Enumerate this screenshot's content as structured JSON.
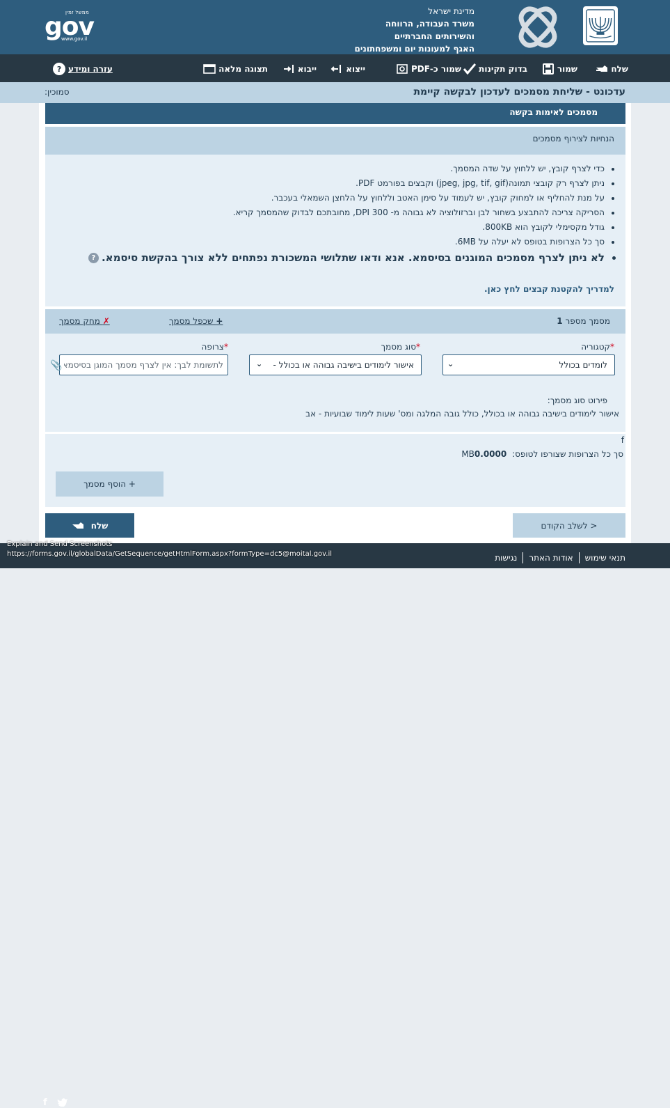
{
  "header": {
    "ministry_lines": [
      "מדינת ישראל",
      "משרד העבודה, הרווחה",
      "והשירותים החברתיים",
      "האגף למעונות יום ומשפחתונים"
    ],
    "gov_logo": {
      "top": "ממשל זמין",
      "main": "gov",
      "url": "www.gov.il"
    }
  },
  "toolbar": {
    "send": "שלח",
    "save": "שמור",
    "validate": "בדוק תקינות",
    "save_pdf": "שמור כ-PDF",
    "export": "ייצוא",
    "import": "ייבוא",
    "fullscreen": "תצוגה מלאה",
    "help": "עזרה ומידע",
    "help_icon_glyph": "?"
  },
  "titlebar": {
    "title": "עדכונט - שליחת מסמכים לעדכון לבקשה קיימת",
    "smochin": "סמוכין:"
  },
  "section": {
    "title": "מסמכים לאימות בקשה",
    "instructions_title": "הנחיות לצירוף מסמכים",
    "instructions": [
      "כדי לצרף קובץ, יש ללחוץ על שדה המסמך.",
      "ניתן לצרף רק קובצי תמונה(jpeg, jpg, tif, gif) וקבצים בפורמט PDF.",
      "על מנת להחליף או למחוק קובץ, יש לעמוד על סימן האטב וללחוץ על הלחצן השמאלי בעכבר.",
      "הסריקה צריכה להתבצע בשחור לבן וברזולוציה לא גבוהה מ- DPI 300, מחובתכם לבדוק שהמסמך קריא.",
      "גודל מקסימלי לקובץ הוא 800KB.",
      "סך כל הצרופות בטופס לא יעלה על 6MB."
    ],
    "warning": "לא ניתן לצרף מסמכים המוגנים בסיסמא. אנא ודאו שתלושי המשכורת נפתחים ללא צורך בהקשת סיסמא.",
    "warning_icon_glyph": "?",
    "guide_link": "למדריך להקטנת קבצים לחץ כאן."
  },
  "document": {
    "title_prefix": "מסמך מספר",
    "number": "1",
    "duplicate": "שכפל מסמך",
    "duplicate_glyph": "+",
    "delete": "מחק מסמך",
    "delete_glyph": "✗",
    "category_label": "קטגוריה",
    "category_value": "לומדים בכולל",
    "doc_type_label": "סוג מסמך",
    "doc_type_value": "אישור לימודים בישיבה גבוהה או בכולל -",
    "attachment_label": "צרופה",
    "attachment_placeholder": "לתשומת לבך: אין לצרף מסמך המוגן בסיסמא",
    "required_mark": "*",
    "chevron_glyph": "⌄",
    "clip_glyph": "📎",
    "desc_label": "פירוט סוג מסמך:",
    "desc_value": "אישור לימודים בישיבה גבוהה או בכולל, כולל גובה המלגה ומס' שעות לימוד שבועיות - אב"
  },
  "totals": {
    "f_char": "f",
    "label": "סך כל הצרופות שצורפו לטופס:",
    "value": "0.0000",
    "unit": "MB",
    "add_button": "+ הוסף מסמך"
  },
  "nav": {
    "prev": "< לשלב הקודם",
    "send": "שלח"
  },
  "footer": {
    "terms": "תנאי שימוש",
    "about": "אודות האתר",
    "accessibility": "נגישות",
    "overlay_line1": "Explain and Send Screenshots",
    "overlay_line2": "https://forms.gov.il/globalData/GetSequence/getHtmlForm.aspx?formType=dc5@moital.gov.il",
    "facebook_glyph": "f"
  },
  "colors": {
    "header_bg": "#2e5d7e",
    "toolbar_bg": "#283844",
    "light_blue": "#bcd3e3",
    "panel_bg": "#e6eff6",
    "required": "#d0021b"
  }
}
